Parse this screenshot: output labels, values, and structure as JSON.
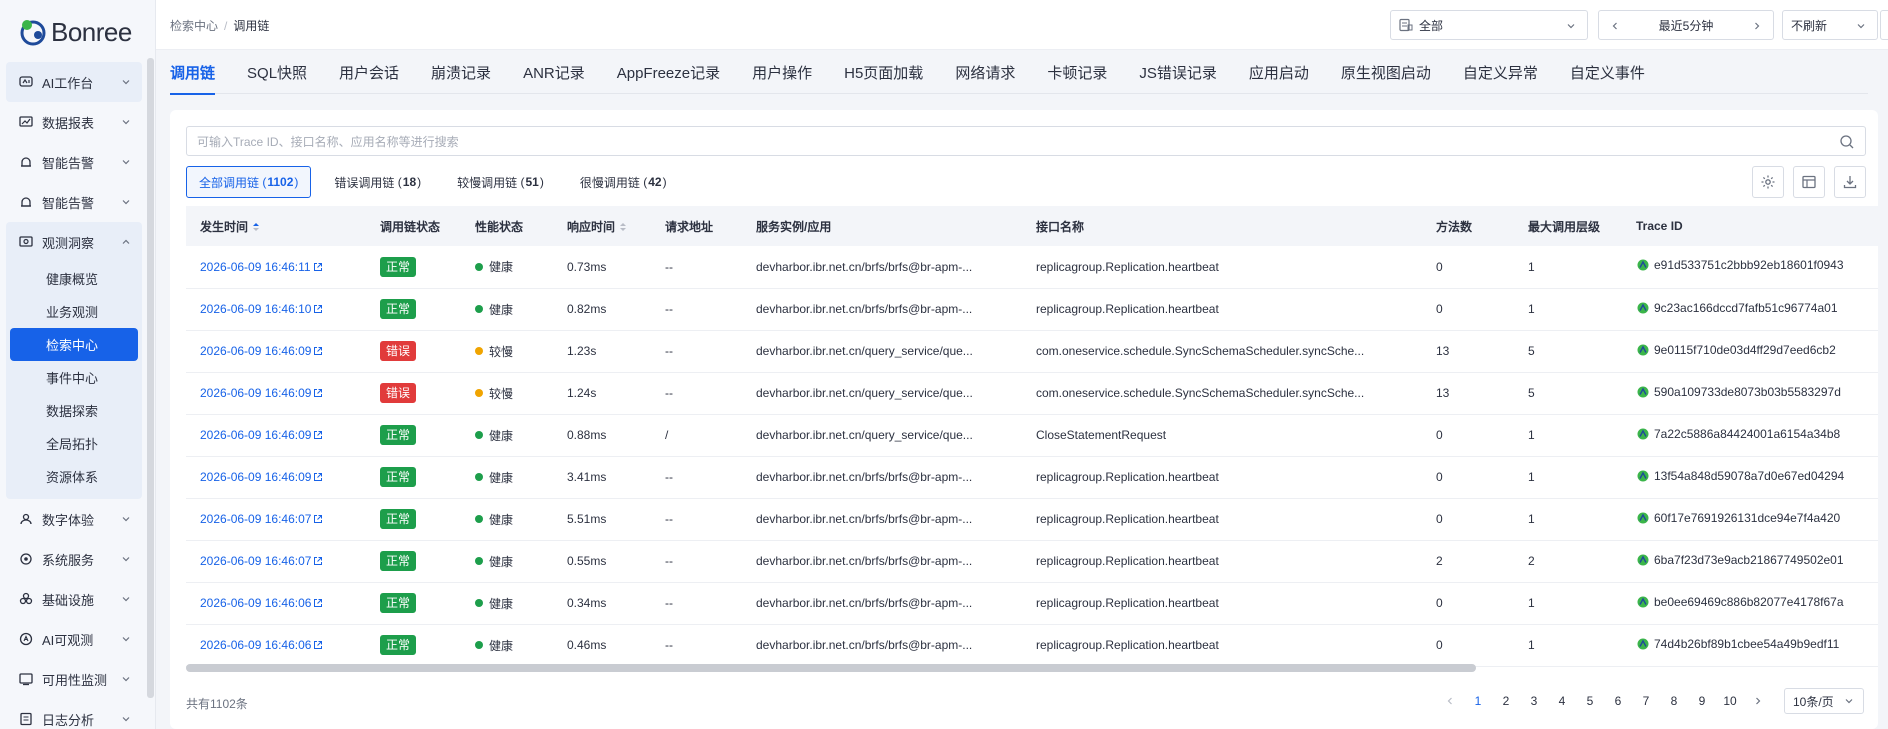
{
  "brand": {
    "name": "Bonree"
  },
  "sidebar": {
    "items": [
      {
        "label": "AI工作台",
        "icon": "ai-workbench-icon"
      },
      {
        "label": "数据报表",
        "icon": "report-icon"
      },
      {
        "label": "智能告警",
        "icon": "alert-icon"
      },
      {
        "label": "智能告警",
        "icon": "alert-icon"
      },
      {
        "label": "观测洞察",
        "icon": "observe-icon"
      }
    ],
    "observe_sub": [
      "健康概览",
      "业务观测",
      "检索中心",
      "事件中心",
      "数据探索",
      "全局拓扑",
      "资源体系"
    ],
    "bottom_items": [
      {
        "label": "数字体验",
        "icon": "user-experience-icon"
      },
      {
        "label": "系统服务",
        "icon": "system-service-icon"
      },
      {
        "label": "基础设施",
        "icon": "infrastructure-icon"
      },
      {
        "label": "AI可观测",
        "icon": "ai-observe-icon"
      },
      {
        "label": "可用性监测",
        "icon": "availability-icon"
      },
      {
        "label": "日志分析",
        "icon": "log-icon"
      }
    ]
  },
  "header": {
    "breadcrumb": [
      "检索中心",
      "调用链"
    ],
    "scope_select": "全部",
    "time_range": "最近5分钟",
    "refresh_select": "不刷新"
  },
  "tabs": [
    "调用链",
    "SQL快照",
    "用户会话",
    "崩溃记录",
    "ANR记录",
    "AppFreeze记录",
    "用户操作",
    "H5页面加载",
    "网络请求",
    "卡顿记录",
    "JS错误记录",
    "应用启动",
    "原生视图启动",
    "自定义异常",
    "自定义事件"
  ],
  "search": {
    "placeholder": "可输入Trace ID、接口名称、应用名称等进行搜索"
  },
  "filters": [
    {
      "label": "全部调用链",
      "count": "1102"
    },
    {
      "label": "错误调用链",
      "count": "18"
    },
    {
      "label": "较慢调用链",
      "count": "51"
    },
    {
      "label": "很慢调用链",
      "count": "42"
    }
  ],
  "table": {
    "columns": [
      "发生时间",
      "调用链状态",
      "性能状态",
      "响应时间",
      "请求地址",
      "服务实例/应用",
      "接口名称",
      "方法数",
      "最大调用层级",
      "Trace ID"
    ],
    "rows": [
      {
        "time": "2026-06-09 16:46:11",
        "status": "正常",
        "status_type": "ok",
        "perf": "健康",
        "perf_color": "#1d9e4b",
        "resp": "0.73ms",
        "url": "--",
        "service": "devharbor.ibr.net.cn/brfs/brfs@br-apm-...",
        "api": "replicagroup.Replication.heartbeat",
        "methods": "0",
        "depth": "1",
        "trace": "e91d533751c2bbb92eb18601f0943"
      },
      {
        "time": "2026-06-09 16:46:10",
        "status": "正常",
        "status_type": "ok",
        "perf": "健康",
        "perf_color": "#1d9e4b",
        "resp": "0.82ms",
        "url": "--",
        "service": "devharbor.ibr.net.cn/brfs/brfs@br-apm-...",
        "api": "replicagroup.Replication.heartbeat",
        "methods": "0",
        "depth": "1",
        "trace": "9c23ac166dccd7fafb51c96774a01"
      },
      {
        "time": "2026-06-09 16:46:09",
        "status": "错误",
        "status_type": "err",
        "perf": "较慢",
        "perf_color": "#f0a400",
        "resp": "1.23s",
        "url": "--",
        "service": "devharbor.ibr.net.cn/query_service/que...",
        "api": "com.oneservice.schedule.SyncSchemaScheduler.syncSche...",
        "methods": "13",
        "depth": "5",
        "trace": "9e0115f710de03d4ff29d7eed6cb2"
      },
      {
        "time": "2026-06-09 16:46:09",
        "status": "错误",
        "status_type": "err",
        "perf": "较慢",
        "perf_color": "#f0a400",
        "resp": "1.24s",
        "url": "--",
        "service": "devharbor.ibr.net.cn/query_service/que...",
        "api": "com.oneservice.schedule.SyncSchemaScheduler.syncSche...",
        "methods": "13",
        "depth": "5",
        "trace": "590a109733de8073b03b5583297d"
      },
      {
        "time": "2026-06-09 16:46:09",
        "status": "正常",
        "status_type": "ok",
        "perf": "健康",
        "perf_color": "#1d9e4b",
        "resp": "0.88ms",
        "url": "/",
        "service": "devharbor.ibr.net.cn/query_service/que...",
        "api": "CloseStatementRequest",
        "methods": "0",
        "depth": "1",
        "trace": "7a22c5886a84424001a6154a34b8"
      },
      {
        "time": "2026-06-09 16:46:09",
        "status": "正常",
        "status_type": "ok",
        "perf": "健康",
        "perf_color": "#1d9e4b",
        "resp": "3.41ms",
        "url": "--",
        "service": "devharbor.ibr.net.cn/brfs/brfs@br-apm-...",
        "api": "replicagroup.Replication.heartbeat",
        "methods": "0",
        "depth": "1",
        "trace": "13f54a848d59078a7d0e67ed04294"
      },
      {
        "time": "2026-06-09 16:46:07",
        "status": "正常",
        "status_type": "ok",
        "perf": "健康",
        "perf_color": "#1d9e4b",
        "resp": "5.51ms",
        "url": "--",
        "service": "devharbor.ibr.net.cn/brfs/brfs@br-apm-...",
        "api": "replicagroup.Replication.heartbeat",
        "methods": "0",
        "depth": "1",
        "trace": "60f17e7691926131dce94e7f4a420"
      },
      {
        "time": "2026-06-09 16:46:07",
        "status": "正常",
        "status_type": "ok",
        "perf": "健康",
        "perf_color": "#1d9e4b",
        "resp": "0.55ms",
        "url": "--",
        "service": "devharbor.ibr.net.cn/brfs/brfs@br-apm-...",
        "api": "replicagroup.Replication.heartbeat",
        "methods": "2",
        "depth": "2",
        "trace": "6ba7f23d73e9acb21867749502e01"
      },
      {
        "time": "2026-06-09 16:46:06",
        "status": "正常",
        "status_type": "ok",
        "perf": "健康",
        "perf_color": "#1d9e4b",
        "resp": "0.34ms",
        "url": "--",
        "service": "devharbor.ibr.net.cn/brfs/brfs@br-apm-...",
        "api": "replicagroup.Replication.heartbeat",
        "methods": "0",
        "depth": "1",
        "trace": "be0ee69469c886b82077e4178f67a"
      },
      {
        "time": "2026-06-09 16:46:06",
        "status": "正常",
        "status_type": "ok",
        "perf": "健康",
        "perf_color": "#1d9e4b",
        "resp": "0.46ms",
        "url": "--",
        "service": "devharbor.ibr.net.cn/brfs/brfs@br-apm-...",
        "api": "replicagroup.Replication.heartbeat",
        "methods": "0",
        "depth": "1",
        "trace": "74d4b26bf89b1cbee54a49b9edf11"
      }
    ]
  },
  "footer": {
    "total": "共有1102条",
    "pages": [
      "1",
      "2",
      "3",
      "4",
      "5",
      "6",
      "7",
      "8",
      "9",
      "10"
    ],
    "current_page": "1",
    "page_size": "10条/页"
  },
  "colors": {
    "accent": "#1762e8",
    "ok": "#1d9e4b",
    "error": "#e13b3b",
    "slow": "#f0a400"
  }
}
